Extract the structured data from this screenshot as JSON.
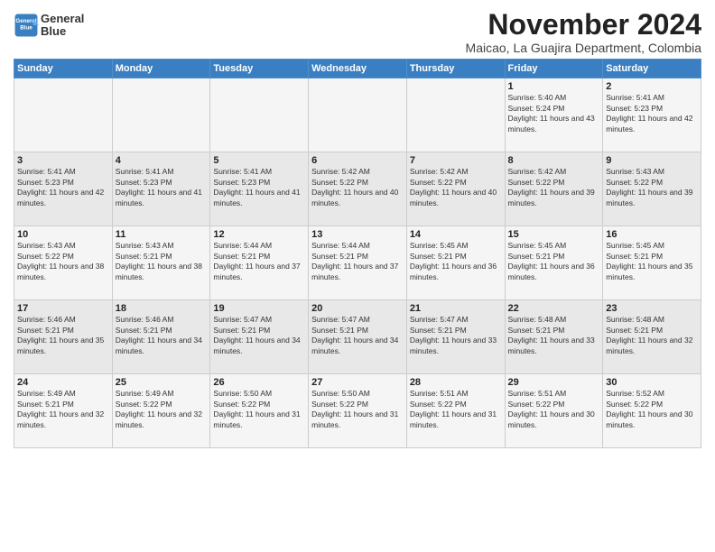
{
  "header": {
    "logo_line1": "General",
    "logo_line2": "Blue",
    "main_title": "November 2024",
    "subtitle": "Maicao, La Guajira Department, Colombia"
  },
  "days_of_week": [
    "Sunday",
    "Monday",
    "Tuesday",
    "Wednesday",
    "Thursday",
    "Friday",
    "Saturday"
  ],
  "weeks": [
    [
      {
        "day": "",
        "info": ""
      },
      {
        "day": "",
        "info": ""
      },
      {
        "day": "",
        "info": ""
      },
      {
        "day": "",
        "info": ""
      },
      {
        "day": "",
        "info": ""
      },
      {
        "day": "1",
        "info": "Sunrise: 5:40 AM\nSunset: 5:24 PM\nDaylight: 11 hours and 43 minutes."
      },
      {
        "day": "2",
        "info": "Sunrise: 5:41 AM\nSunset: 5:23 PM\nDaylight: 11 hours and 42 minutes."
      }
    ],
    [
      {
        "day": "3",
        "info": "Sunrise: 5:41 AM\nSunset: 5:23 PM\nDaylight: 11 hours and 42 minutes."
      },
      {
        "day": "4",
        "info": "Sunrise: 5:41 AM\nSunset: 5:23 PM\nDaylight: 11 hours and 41 minutes."
      },
      {
        "day": "5",
        "info": "Sunrise: 5:41 AM\nSunset: 5:23 PM\nDaylight: 11 hours and 41 minutes."
      },
      {
        "day": "6",
        "info": "Sunrise: 5:42 AM\nSunset: 5:22 PM\nDaylight: 11 hours and 40 minutes."
      },
      {
        "day": "7",
        "info": "Sunrise: 5:42 AM\nSunset: 5:22 PM\nDaylight: 11 hours and 40 minutes."
      },
      {
        "day": "8",
        "info": "Sunrise: 5:42 AM\nSunset: 5:22 PM\nDaylight: 11 hours and 39 minutes."
      },
      {
        "day": "9",
        "info": "Sunrise: 5:43 AM\nSunset: 5:22 PM\nDaylight: 11 hours and 39 minutes."
      }
    ],
    [
      {
        "day": "10",
        "info": "Sunrise: 5:43 AM\nSunset: 5:22 PM\nDaylight: 11 hours and 38 minutes."
      },
      {
        "day": "11",
        "info": "Sunrise: 5:43 AM\nSunset: 5:21 PM\nDaylight: 11 hours and 38 minutes."
      },
      {
        "day": "12",
        "info": "Sunrise: 5:44 AM\nSunset: 5:21 PM\nDaylight: 11 hours and 37 minutes."
      },
      {
        "day": "13",
        "info": "Sunrise: 5:44 AM\nSunset: 5:21 PM\nDaylight: 11 hours and 37 minutes."
      },
      {
        "day": "14",
        "info": "Sunrise: 5:45 AM\nSunset: 5:21 PM\nDaylight: 11 hours and 36 minutes."
      },
      {
        "day": "15",
        "info": "Sunrise: 5:45 AM\nSunset: 5:21 PM\nDaylight: 11 hours and 36 minutes."
      },
      {
        "day": "16",
        "info": "Sunrise: 5:45 AM\nSunset: 5:21 PM\nDaylight: 11 hours and 35 minutes."
      }
    ],
    [
      {
        "day": "17",
        "info": "Sunrise: 5:46 AM\nSunset: 5:21 PM\nDaylight: 11 hours and 35 minutes."
      },
      {
        "day": "18",
        "info": "Sunrise: 5:46 AM\nSunset: 5:21 PM\nDaylight: 11 hours and 34 minutes."
      },
      {
        "day": "19",
        "info": "Sunrise: 5:47 AM\nSunset: 5:21 PM\nDaylight: 11 hours and 34 minutes."
      },
      {
        "day": "20",
        "info": "Sunrise: 5:47 AM\nSunset: 5:21 PM\nDaylight: 11 hours and 34 minutes."
      },
      {
        "day": "21",
        "info": "Sunrise: 5:47 AM\nSunset: 5:21 PM\nDaylight: 11 hours and 33 minutes."
      },
      {
        "day": "22",
        "info": "Sunrise: 5:48 AM\nSunset: 5:21 PM\nDaylight: 11 hours and 33 minutes."
      },
      {
        "day": "23",
        "info": "Sunrise: 5:48 AM\nSunset: 5:21 PM\nDaylight: 11 hours and 32 minutes."
      }
    ],
    [
      {
        "day": "24",
        "info": "Sunrise: 5:49 AM\nSunset: 5:21 PM\nDaylight: 11 hours and 32 minutes."
      },
      {
        "day": "25",
        "info": "Sunrise: 5:49 AM\nSunset: 5:22 PM\nDaylight: 11 hours and 32 minutes."
      },
      {
        "day": "26",
        "info": "Sunrise: 5:50 AM\nSunset: 5:22 PM\nDaylight: 11 hours and 31 minutes."
      },
      {
        "day": "27",
        "info": "Sunrise: 5:50 AM\nSunset: 5:22 PM\nDaylight: 11 hours and 31 minutes."
      },
      {
        "day": "28",
        "info": "Sunrise: 5:51 AM\nSunset: 5:22 PM\nDaylight: 11 hours and 31 minutes."
      },
      {
        "day": "29",
        "info": "Sunrise: 5:51 AM\nSunset: 5:22 PM\nDaylight: 11 hours and 30 minutes."
      },
      {
        "day": "30",
        "info": "Sunrise: 5:52 AM\nSunset: 5:22 PM\nDaylight: 11 hours and 30 minutes."
      }
    ]
  ]
}
